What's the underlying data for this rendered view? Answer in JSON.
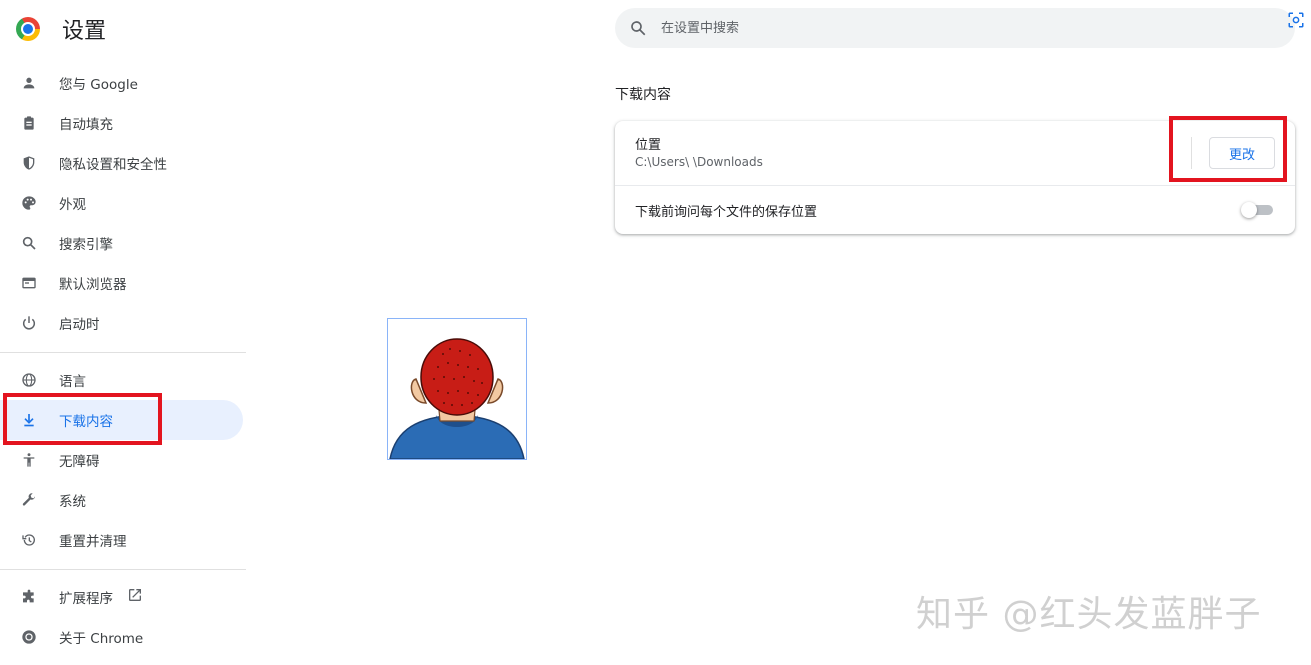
{
  "app": {
    "title": "设置"
  },
  "search": {
    "placeholder": "在设置中搜索"
  },
  "sidebar": {
    "items": [
      {
        "label": "您与 Google",
        "icon": "person-icon"
      },
      {
        "label": "自动填充",
        "icon": "clipboard-icon"
      },
      {
        "label": "隐私设置和安全性",
        "icon": "shield-icon"
      },
      {
        "label": "外观",
        "icon": "palette-icon"
      },
      {
        "label": "搜索引擎",
        "icon": "search-icon"
      },
      {
        "label": "默认浏览器",
        "icon": "browser-icon"
      },
      {
        "label": "启动时",
        "icon": "power-icon"
      },
      {
        "label": "语言",
        "icon": "globe-icon"
      },
      {
        "label": "下载内容",
        "icon": "download-icon",
        "active": true
      },
      {
        "label": "无障碍",
        "icon": "accessibility-icon"
      },
      {
        "label": "系统",
        "icon": "wrench-icon"
      },
      {
        "label": "重置并清理",
        "icon": "history-icon"
      },
      {
        "label": "扩展程序",
        "icon": "puzzle-icon"
      },
      {
        "label": "关于 Chrome",
        "icon": "chrome-icon"
      }
    ]
  },
  "downloads": {
    "section_title": "下载内容",
    "location_label": "位置",
    "location_path": "C:\\Users\\      \\Downloads",
    "change_button": "更改",
    "ask_label": "下载前询问每个文件的保存位置",
    "ask_enabled": false
  },
  "watermark": "知乎 @红头发蓝胖子",
  "colors": {
    "accent": "#1a73e8",
    "highlight_box": "#e3141f",
    "active_bg": "#e8f0fe"
  }
}
